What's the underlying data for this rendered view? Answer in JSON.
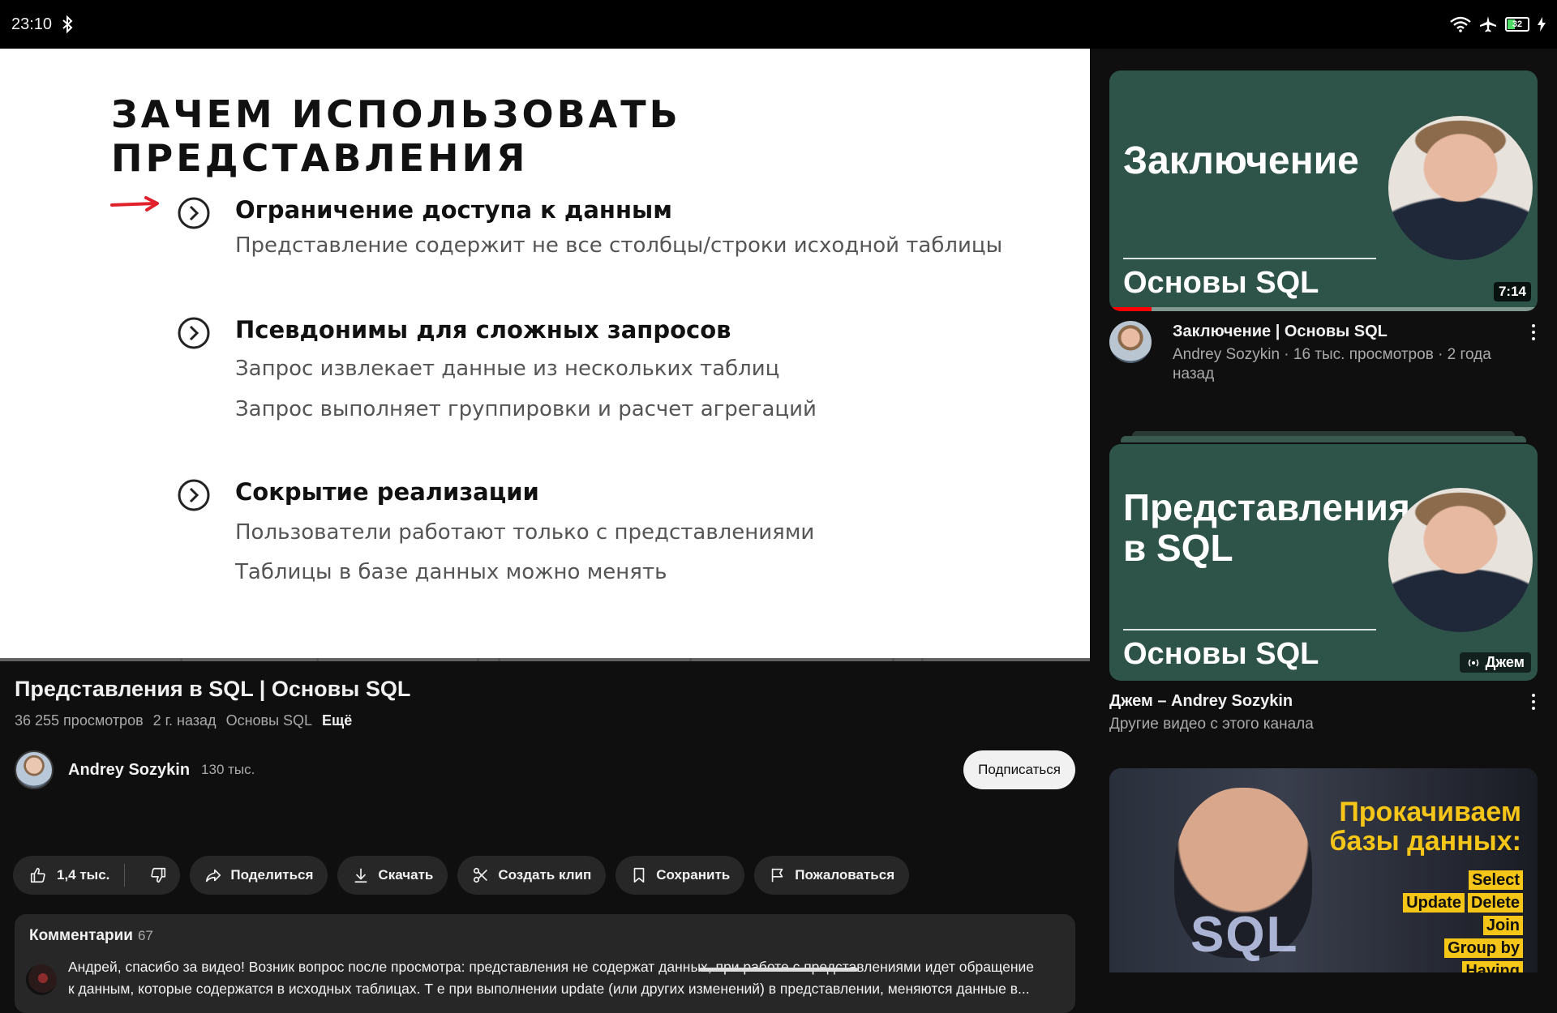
{
  "status": {
    "time": "23:10",
    "battery": "32"
  },
  "slide": {
    "title": "ЗАЧЕМ ИСПОЛЬЗОВАТЬ ПРЕДСТАВЛЕНИЯ",
    "points": [
      {
        "head": "Ограничение доступа к данным",
        "subs": [
          "Представление содержит не все столбцы/строки исходной таблицы"
        ]
      },
      {
        "head": "Псевдонимы для сложных запросов",
        "subs": [
          "Запрос извлекает данные из нескольких таблиц",
          "Запрос выполняет группировки и расчет агрегаций"
        ]
      },
      {
        "head": "Сокрытие реализации",
        "subs": [
          "Пользователи работают только с представлениями",
          "Таблицы в базе данных можно менять"
        ]
      }
    ]
  },
  "video": {
    "title": "Представления в SQL | Основы SQL",
    "views": "36 255 просмотров",
    "age": "2 г. назад",
    "playlist": "Основы SQL",
    "more": "Ещё"
  },
  "channel": {
    "name": "Andrey Sozykin",
    "subs": "130 тыс.",
    "subscribe_label": "Подписаться"
  },
  "actions": {
    "likes": "1,4 тыс.",
    "share": "Поделиться",
    "download": "Скачать",
    "clip": "Создать клип",
    "save": "Сохранить",
    "report": "Пожаловаться"
  },
  "comments": {
    "label": "Комментарии",
    "count": "67",
    "line1": "Андрей, спасибо за видео! Возник вопрос после просмотра: представления не содержат данных, при работе с представлениями идет обращение",
    "line2": "к данным, которые содержатся в исходных таблицах. Т е при выполнении update (или других изменений) в представлении, меняются данные в..."
  },
  "related": [
    {
      "thumb_title": "Заключение",
      "thumb_sub": "Основы SQL",
      "duration": "7:14",
      "title": "Заключение | Основы SQL",
      "meta": "Andrey Sozykin · 16 тыс. просмотров · 2 года назад"
    },
    {
      "thumb_title_1": "Представления",
      "thumb_title_2": "в SQL",
      "thumb_sub": "Основы SQL",
      "badge": "Джем",
      "title": "Джем – Andrey Sozykin",
      "meta": "Другие видео с этого канала"
    },
    {
      "thumb_head_1": "Прокачиваем",
      "thumb_head_2": "базы данных:",
      "thumb_sql": "SQL",
      "tags": [
        "Select",
        "Update",
        "Delete",
        "Join",
        "Group by",
        "Having"
      ]
    }
  ],
  "colors": {
    "accent_red": "#ff0000",
    "thumb_green": "#2e5449",
    "tag_yellow": "#f5c518"
  }
}
